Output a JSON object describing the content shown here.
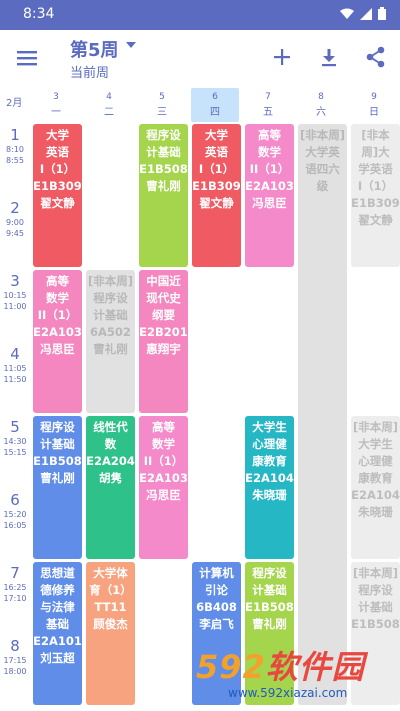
{
  "status_bar": {
    "time": "8:34",
    "icons": [
      "wifi-icon",
      "signal-icon",
      "battery-icon"
    ]
  },
  "app_bar": {
    "week_title": "第5周",
    "week_subtitle": "当前周",
    "actions": [
      "add-icon",
      "download-icon",
      "share-icon"
    ]
  },
  "grid": {
    "month": "2月",
    "days": [
      {
        "num": "3",
        "name": "一"
      },
      {
        "num": "4",
        "name": "二"
      },
      {
        "num": "5",
        "name": "三"
      },
      {
        "num": "6",
        "name": "四",
        "today": true
      },
      {
        "num": "7",
        "name": "五"
      },
      {
        "num": "8",
        "name": "六"
      },
      {
        "num": "9",
        "name": "日"
      }
    ],
    "periods": [
      {
        "n": "1",
        "start": "8:10",
        "end": "8:55"
      },
      {
        "n": "2",
        "start": "9:00",
        "end": "9:45"
      },
      {
        "n": "3",
        "start": "10:15",
        "end": "11:00"
      },
      {
        "n": "4",
        "start": "11:05",
        "end": "11:50"
      },
      {
        "n": "5",
        "start": "14:30",
        "end": "15:15"
      },
      {
        "n": "6",
        "start": "15:20",
        "end": "16:05"
      },
      {
        "n": "7",
        "start": "16:25",
        "end": "17:10"
      },
      {
        "n": "8",
        "start": "17:15",
        "end": "18:00"
      }
    ]
  },
  "courses": [
    {
      "day": 1,
      "start": 1,
      "len": 2,
      "color": "red",
      "lines": [
        "大学",
        "英语",
        "I（1）",
        "E1B309",
        "翟文静"
      ]
    },
    {
      "day": 3,
      "start": 1,
      "len": 2,
      "color": "green",
      "lines": [
        "程序设",
        "计基础",
        "E1B508",
        "曹礼刚"
      ]
    },
    {
      "day": 4,
      "start": 1,
      "len": 2,
      "color": "red",
      "lines": [
        "大学",
        "英语",
        "I（1）",
        "E1B309",
        "翟文静"
      ]
    },
    {
      "day": 5,
      "start": 1,
      "len": 2,
      "color": "pink",
      "lines": [
        "高等",
        "数学",
        "II（1）",
        "E2A103",
        "冯思臣"
      ]
    },
    {
      "day": 6,
      "start": 1,
      "len": 8,
      "color": "gray",
      "lines": [
        "[非本周]",
        "大学英",
        "语四六",
        "级"
      ]
    },
    {
      "day": 7,
      "start": 1,
      "len": 2,
      "color": "gray2",
      "lines": [
        "[非本",
        "周]大",
        "学英语",
        "I（1）",
        "E1B309",
        "翟文静"
      ]
    },
    {
      "day": 1,
      "start": 3,
      "len": 2,
      "color": "rose",
      "lines": [
        "高等",
        "数学",
        "II（1）",
        "E2A103",
        "冯思臣"
      ]
    },
    {
      "day": 2,
      "start": 3,
      "len": 2,
      "color": "gray",
      "lines": [
        "[非本周]",
        "程序设",
        "计基础",
        "6A502",
        "曹礼刚"
      ]
    },
    {
      "day": 3,
      "start": 3,
      "len": 2,
      "color": "rose",
      "lines": [
        "中国近",
        "现代史",
        "纲要",
        "E2B201",
        "惠翔宇"
      ]
    },
    {
      "day": 1,
      "start": 5,
      "len": 2,
      "color": "blue",
      "lines": [
        "程序设",
        "计基础",
        "E1B508",
        "曹礼刚"
      ]
    },
    {
      "day": 2,
      "start": 5,
      "len": 2,
      "color": "teal",
      "lines": [
        "线性代",
        "数",
        "E2A204",
        "胡隽"
      ]
    },
    {
      "day": 3,
      "start": 5,
      "len": 2,
      "color": "pink",
      "lines": [
        "高等",
        "数学",
        "II（1）",
        "E2A103",
        "冯思臣"
      ]
    },
    {
      "day": 5,
      "start": 5,
      "len": 2,
      "color": "cyan",
      "lines": [
        "大学生",
        "心理健",
        "康教育",
        "E2A104",
        "朱晓珊"
      ]
    },
    {
      "day": 7,
      "start": 5,
      "len": 2,
      "color": "gray2",
      "lines": [
        "[非本周]",
        "大学生",
        "心理健",
        "康教育",
        "E2A104",
        "朱晓珊"
      ]
    },
    {
      "day": 1,
      "start": 7,
      "len": 2,
      "color": "blue",
      "lines": [
        "思想道",
        "德修养",
        "与法律",
        "基础",
        "E2A101",
        "刘玉超"
      ]
    },
    {
      "day": 2,
      "start": 7,
      "len": 2,
      "color": "orange",
      "lines": [
        "大学体",
        "育（1）",
        "TT11",
        "顾俊杰"
      ]
    },
    {
      "day": 4,
      "start": 7,
      "len": 2,
      "color": "blue",
      "lines": [
        "计算机",
        "引论",
        "6B408",
        "李启飞"
      ]
    },
    {
      "day": 5,
      "start": 7,
      "len": 2,
      "color": "green",
      "lines": [
        "程序设",
        "计基础",
        "E1B508",
        "曹礼刚"
      ]
    },
    {
      "day": 7,
      "start": 7,
      "len": 2,
      "color": "gray2",
      "lines": [
        "[非本周]",
        "程序设",
        "计基础",
        "E1B508"
      ]
    }
  ],
  "watermark": {
    "brand_num": "592",
    "brand_text": "软件园",
    "url": "www.592xiazai.com"
  }
}
